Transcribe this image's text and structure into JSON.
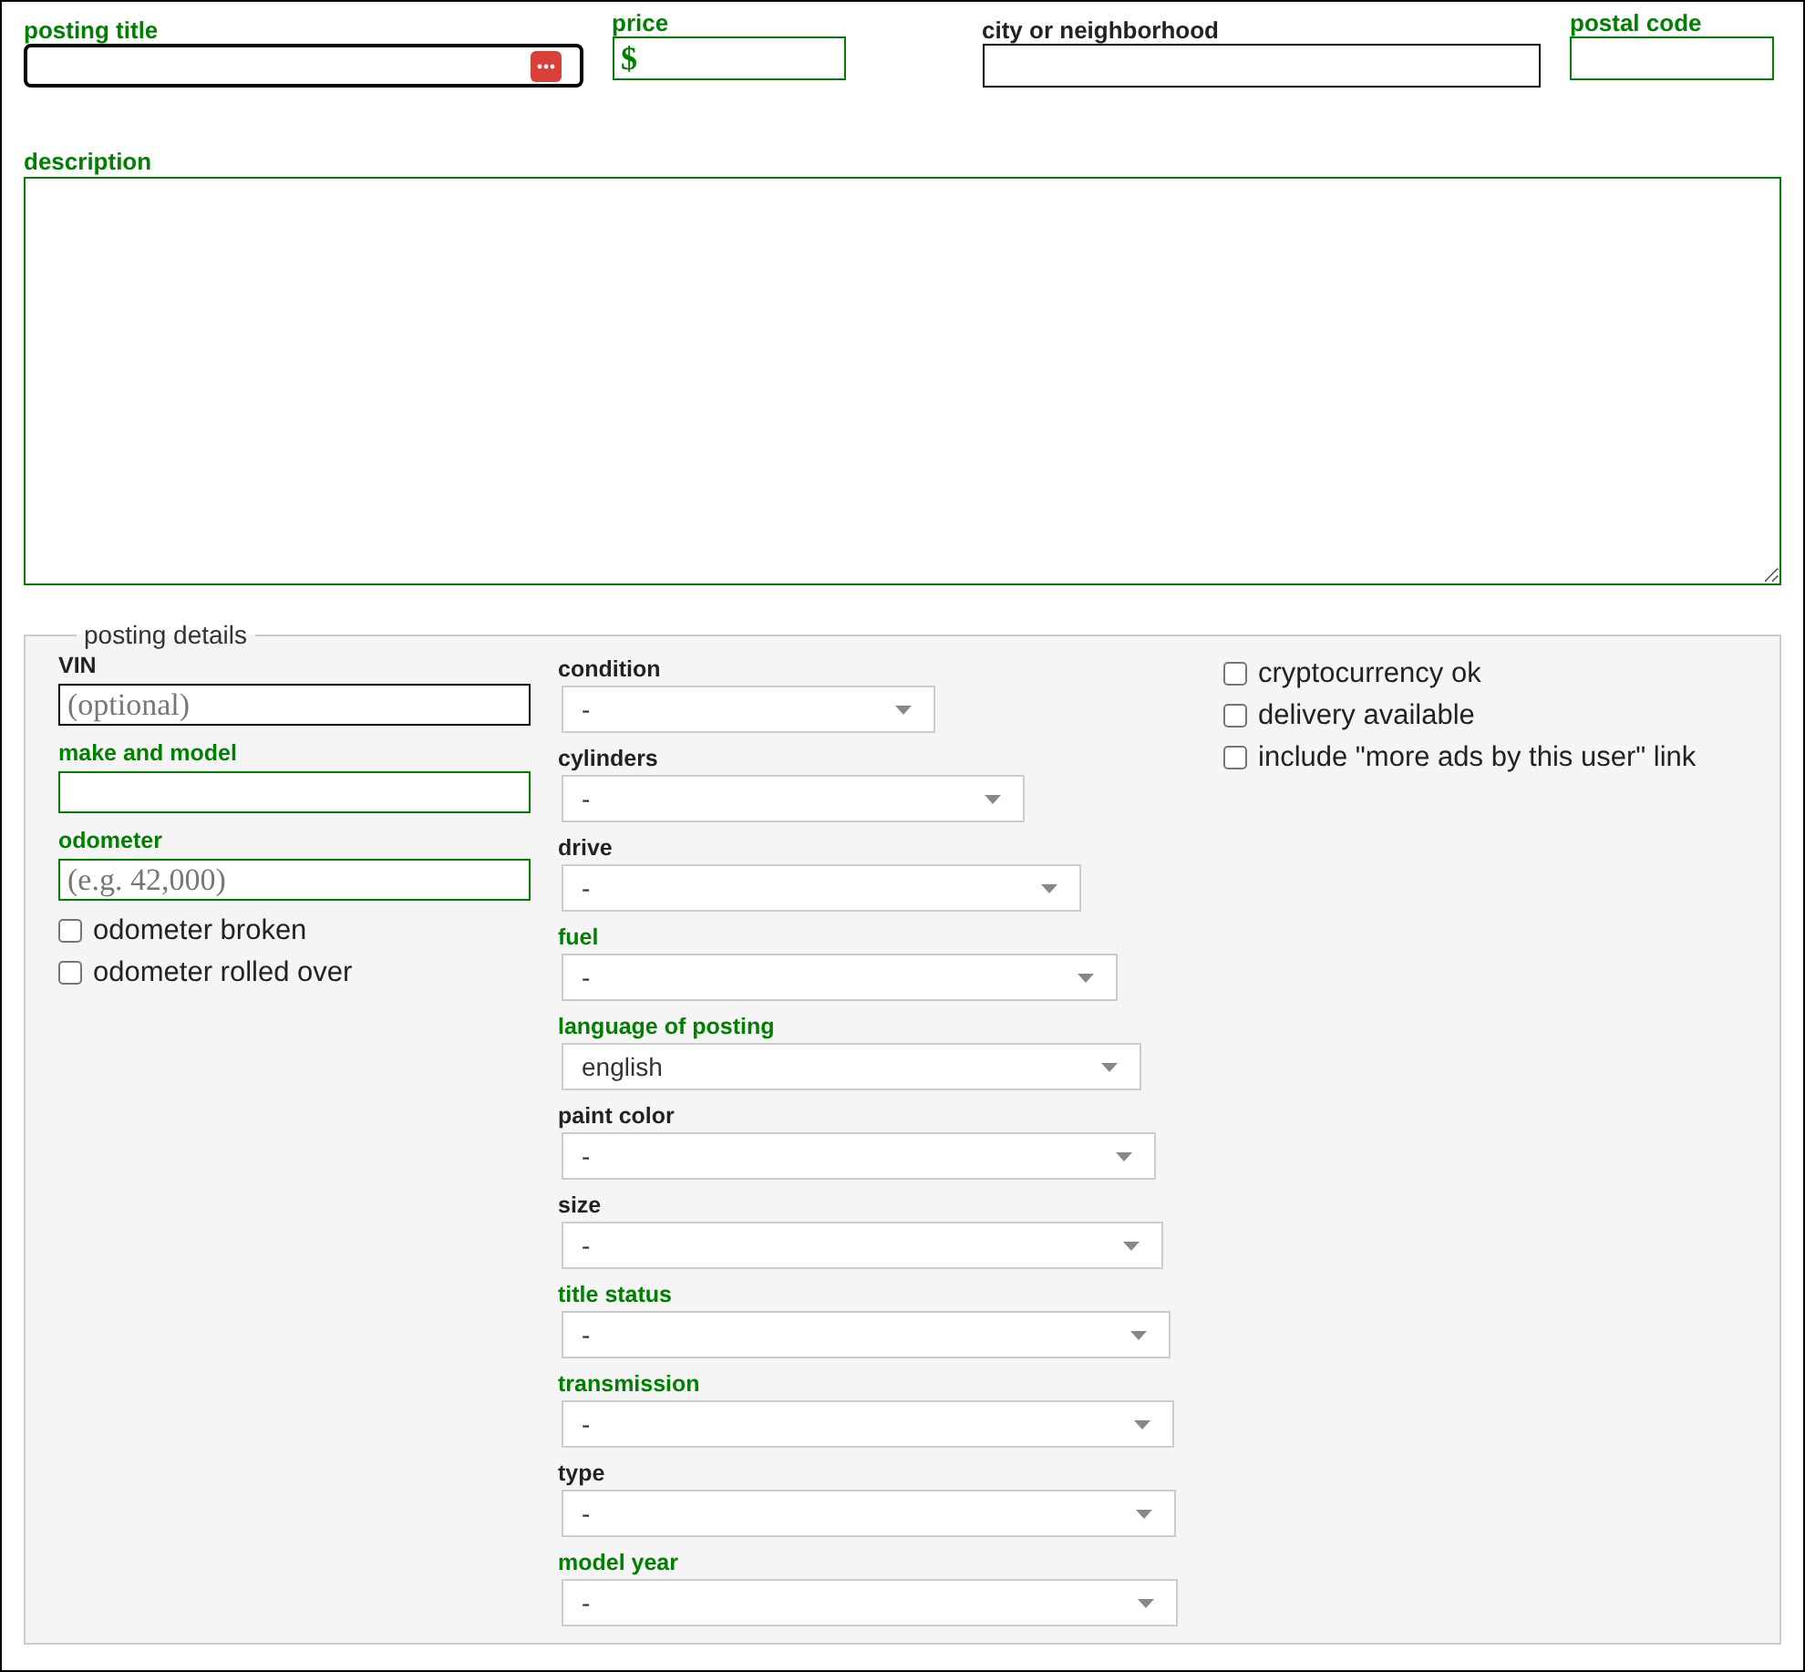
{
  "top_fields": [
    {
      "label": "posting title",
      "required": true,
      "focused": true,
      "has_menu_icon": true
    },
    {
      "label": "price",
      "required": true,
      "focused": false,
      "prefix": "$"
    },
    {
      "label": "city or neighborhood",
      "required": false,
      "focused": false
    },
    {
      "label": "postal code",
      "required": true,
      "focused": false
    }
  ],
  "description": {
    "label": "description",
    "required": true
  },
  "posting_details": {
    "legend": "posting details",
    "fields": [
      {
        "label": "VIN",
        "required": false,
        "placeholder": "(optional)"
      },
      {
        "label": "make and model",
        "required": true
      },
      {
        "label": "odometer",
        "required": true,
        "placeholder": "(e.g. 42,000)"
      }
    ],
    "odometer_options": [
      {
        "label": "odometer broken",
        "checked": false
      },
      {
        "label": "odometer rolled over",
        "checked": false
      }
    ],
    "selects": [
      {
        "label": "condition",
        "required": false,
        "value": "-"
      },
      {
        "label": "cylinders",
        "required": false,
        "value": "-"
      },
      {
        "label": "drive",
        "required": false,
        "value": "-"
      },
      {
        "label": "fuel",
        "required": true,
        "value": "-"
      },
      {
        "label": "language of posting",
        "required": true,
        "value": "english"
      },
      {
        "label": "paint color",
        "required": false,
        "value": "-"
      },
      {
        "label": "size",
        "required": false,
        "value": "-"
      },
      {
        "label": "title status",
        "required": true,
        "value": "-"
      },
      {
        "label": "transmission",
        "required": true,
        "value": "-"
      },
      {
        "label": "type",
        "required": false,
        "value": "-"
      },
      {
        "label": "model year",
        "required": true,
        "value": "-"
      }
    ],
    "options": [
      {
        "label": "cryptocurrency ok",
        "checked": false
      },
      {
        "label": "delivery available",
        "checked": false
      },
      {
        "label": "include \"more ads by this user\" link",
        "checked": false
      }
    ]
  }
}
